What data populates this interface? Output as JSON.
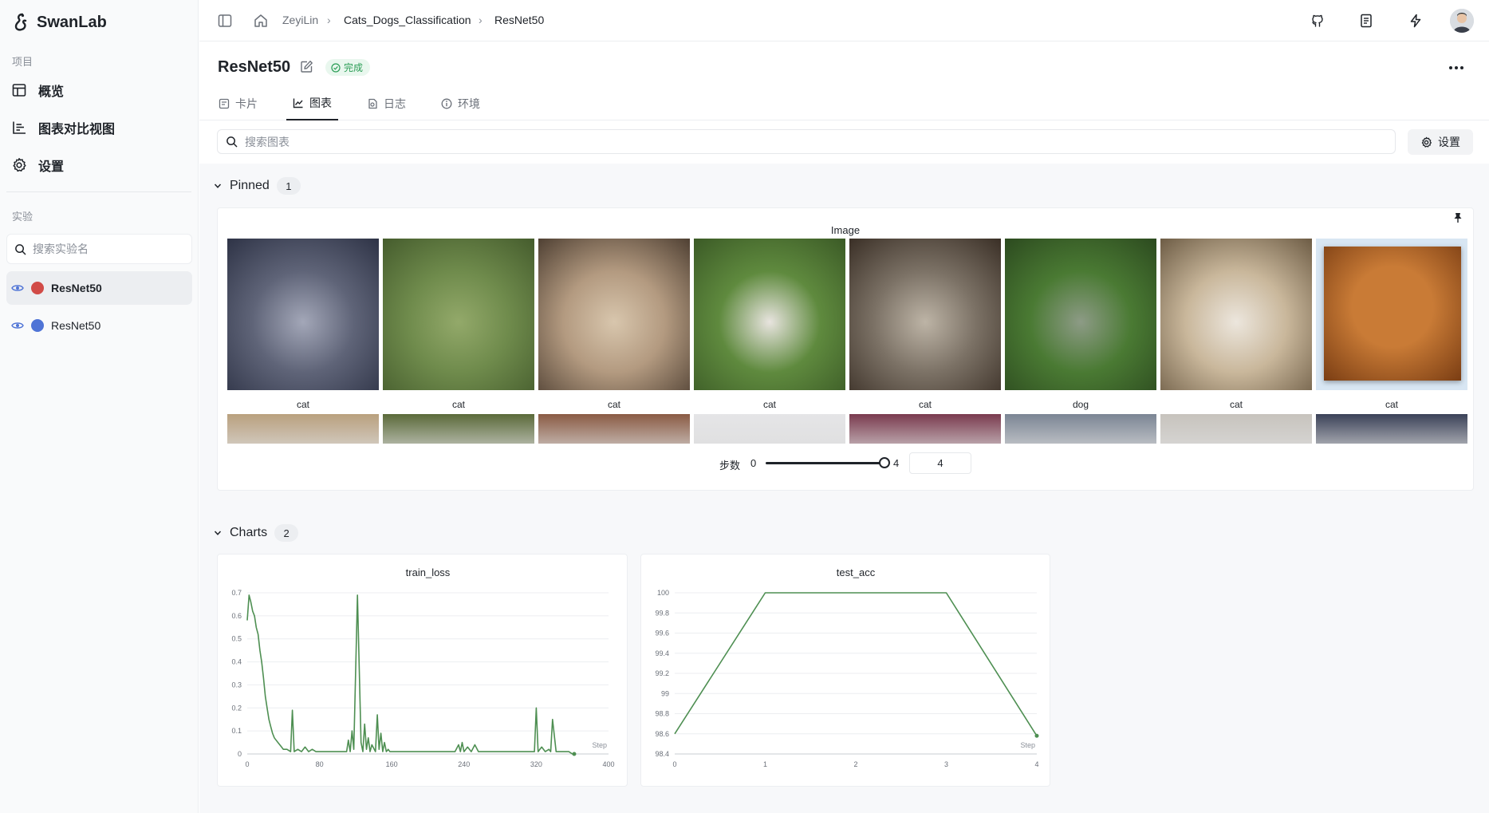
{
  "app": {
    "name": "SwanLab"
  },
  "sidebar": {
    "project_label": "项目",
    "nav": [
      {
        "label": "概览",
        "icon": "table-icon"
      },
      {
        "label": "图表对比视图",
        "icon": "bar-chart-icon"
      },
      {
        "label": "设置",
        "icon": "gear-icon"
      }
    ],
    "experiments_label": "实验",
    "search_placeholder": "搜索实验名",
    "experiments": [
      {
        "name": "ResNet50",
        "color": "#d14b47",
        "active": true
      },
      {
        "name": "ResNet50",
        "color": "#4f74d6",
        "active": false
      }
    ]
  },
  "breadcrumb": {
    "user": "ZeyiLin",
    "project": "Cats_Dogs_Classification",
    "run": "ResNet50"
  },
  "header": {
    "title": "ResNet50",
    "status": "完成"
  },
  "tabs": [
    {
      "label": "卡片",
      "icon": "card-icon"
    },
    {
      "label": "图表",
      "icon": "chart-icon",
      "active": true
    },
    {
      "label": "日志",
      "icon": "log-icon"
    },
    {
      "label": "环境",
      "icon": "info-icon"
    }
  ],
  "search": {
    "placeholder": "搜索图表"
  },
  "settings_label": "设置",
  "pinned": {
    "title": "Pinned",
    "count": "1",
    "panel": {
      "title": "Image",
      "images": [
        {
          "label": "cat",
          "colors": [
            "#5f6478",
            "#a3a7b8",
            "#2e3346"
          ]
        },
        {
          "label": "cat",
          "colors": [
            "#6f8b4c",
            "#93a96a",
            "#455c2d"
          ]
        },
        {
          "label": "cat",
          "colors": [
            "#b39a80",
            "#d8c6ad",
            "#4f4033"
          ]
        },
        {
          "label": "cat",
          "colors": [
            "#5f8a3e",
            "#e8e4df",
            "#3b5a26"
          ]
        },
        {
          "label": "cat",
          "colors": [
            "#7c7266",
            "#bdb4a6",
            "#3a2f26"
          ]
        },
        {
          "label": "dog",
          "colors": [
            "#4a7a33",
            "#8d9b86",
            "#2c4a1f"
          ]
        },
        {
          "label": "cat",
          "colors": [
            "#c9b79b",
            "#ece6dd",
            "#6d5c45"
          ]
        },
        {
          "label": "cat",
          "colors": [
            "#d8e6f3",
            "#c97b36",
            "#7a3d13"
          ]
        }
      ],
      "second_row_colors": [
        "#b9a07e",
        "#5b6a3a",
        "#8a5b44",
        "#e5e5e7",
        "#7a3b4f",
        "#7b8594",
        "#c7c3bd",
        "#3b4258"
      ],
      "step_label": "步数",
      "step_min": "0",
      "step_max": "4",
      "step_value": "4"
    }
  },
  "charts": {
    "title": "Charts",
    "count": "2"
  },
  "chart_data": [
    {
      "type": "line",
      "title": "train_loss",
      "xlabel": "Step",
      "ylabel": "",
      "xlim": [
        0,
        400
      ],
      "ylim": [
        0,
        0.7
      ],
      "xticks": [
        "0",
        "80",
        "160",
        "240",
        "320",
        "400"
      ],
      "yticks": [
        "0",
        "0.1",
        "0.2",
        "0.3",
        "0.4",
        "0.5",
        "0.6",
        "0.7"
      ],
      "color": "#4e8f52",
      "series": [
        {
          "x": [
            0,
            2,
            4,
            6,
            8,
            10,
            12,
            14,
            16,
            18,
            20,
            22,
            24,
            26,
            28,
            30,
            32,
            34,
            36,
            38,
            40,
            44,
            48,
            50,
            52,
            56,
            60,
            64,
            68,
            72,
            76,
            80,
            90,
            100,
            110,
            112,
            114,
            116,
            118,
            122,
            126,
            128,
            130,
            132,
            134,
            136,
            138,
            142,
            144,
            146,
            148,
            150,
            152,
            154,
            156,
            158,
            160,
            164,
            170,
            180,
            190,
            200,
            210,
            220,
            230,
            234,
            236,
            238,
            240,
            244,
            248,
            252,
            256,
            260,
            270,
            280,
            290,
            300,
            310,
            318,
            320,
            322,
            326,
            330,
            334,
            336,
            338,
            342,
            350,
            356,
            360,
            362
          ],
          "y": [
            0.58,
            0.69,
            0.66,
            0.62,
            0.6,
            0.55,
            0.52,
            0.45,
            0.4,
            0.33,
            0.25,
            0.2,
            0.15,
            0.12,
            0.09,
            0.07,
            0.06,
            0.05,
            0.04,
            0.03,
            0.02,
            0.02,
            0.01,
            0.19,
            0.01,
            0.02,
            0.01,
            0.03,
            0.01,
            0.02,
            0.01,
            0.01,
            0.01,
            0.01,
            0.01,
            0.06,
            0.01,
            0.1,
            0.02,
            0.69,
            0.05,
            0.01,
            0.13,
            0.02,
            0.07,
            0.01,
            0.04,
            0.01,
            0.17,
            0.02,
            0.09,
            0.01,
            0.05,
            0.01,
            0.02,
            0.01,
            0.01,
            0.01,
            0.01,
            0.01,
            0.01,
            0.01,
            0.01,
            0.01,
            0.01,
            0.04,
            0.01,
            0.05,
            0.01,
            0.03,
            0.01,
            0.04,
            0.01,
            0.01,
            0.01,
            0.01,
            0.01,
            0.01,
            0.01,
            0.01,
            0.2,
            0.01,
            0.03,
            0.01,
            0.02,
            0.01,
            0.15,
            0.01,
            0.01,
            0.01,
            0.0,
            0.0
          ]
        }
      ]
    },
    {
      "type": "line",
      "title": "test_acc",
      "xlabel": "Step",
      "ylabel": "",
      "xlim": [
        0,
        4
      ],
      "ylim": [
        98.4,
        100
      ],
      "xticks": [
        "0",
        "1",
        "2",
        "3",
        "4"
      ],
      "yticks": [
        "98.4",
        "98.6",
        "98.8",
        "99",
        "99.2",
        "99.4",
        "99.6",
        "99.8",
        "100"
      ],
      "color": "#4e8f52",
      "series": [
        {
          "x": [
            0,
            1,
            2,
            3,
            4
          ],
          "y": [
            98.6,
            100,
            100,
            100,
            98.58
          ]
        }
      ]
    }
  ]
}
